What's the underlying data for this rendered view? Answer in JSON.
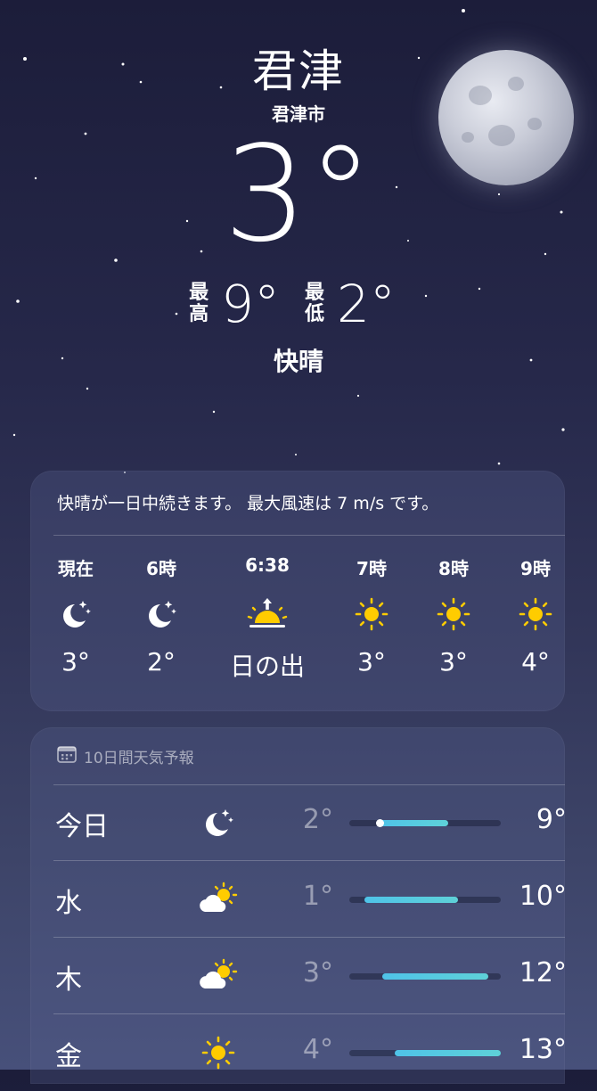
{
  "location": {
    "city": "君津",
    "subtitle": "君津市"
  },
  "current": {
    "temp": "3°",
    "high_label_1": "最",
    "high_label_2": "高",
    "high": "9°",
    "low_label_1": "最",
    "low_label_2": "低",
    "low": "2°",
    "condition": "快晴"
  },
  "hourly": {
    "summary": "快晴が一日中続きます。 最大風速は 7 m/s です。",
    "items": [
      {
        "time": "現在",
        "icon": "moon-stars-icon",
        "value": "3°"
      },
      {
        "time": "6時",
        "icon": "moon-stars-icon",
        "value": "2°"
      },
      {
        "time": "6:38",
        "icon": "sunrise-icon",
        "value": "日の出"
      },
      {
        "time": "7時",
        "icon": "sun-icon",
        "value": "3°"
      },
      {
        "time": "8時",
        "icon": "sun-icon",
        "value": "3°"
      },
      {
        "time": "9時",
        "icon": "sun-icon",
        "value": "4°"
      }
    ]
  },
  "forecast": {
    "header": "10日間天気予報",
    "days": [
      {
        "day": "今日",
        "icon": "moon-stars-icon",
        "low": "2°",
        "high": "9°",
        "range_start": 0.2,
        "range_end": 0.65,
        "current_marker": 0.2
      },
      {
        "day": "水",
        "icon": "partly-sunny-icon",
        "low": "1°",
        "high": "10°",
        "range_start": 0.1,
        "range_end": 0.72
      },
      {
        "day": "木",
        "icon": "partly-sunny-icon",
        "low": "3°",
        "high": "12°",
        "range_start": 0.22,
        "range_end": 0.92
      },
      {
        "day": "金",
        "icon": "sun-icon",
        "low": "4°",
        "high": "13°",
        "range_start": 0.3,
        "range_end": 1.0
      }
    ]
  },
  "colors": {
    "bar": "#4fc3e8",
    "sun": "#ffcc00"
  }
}
